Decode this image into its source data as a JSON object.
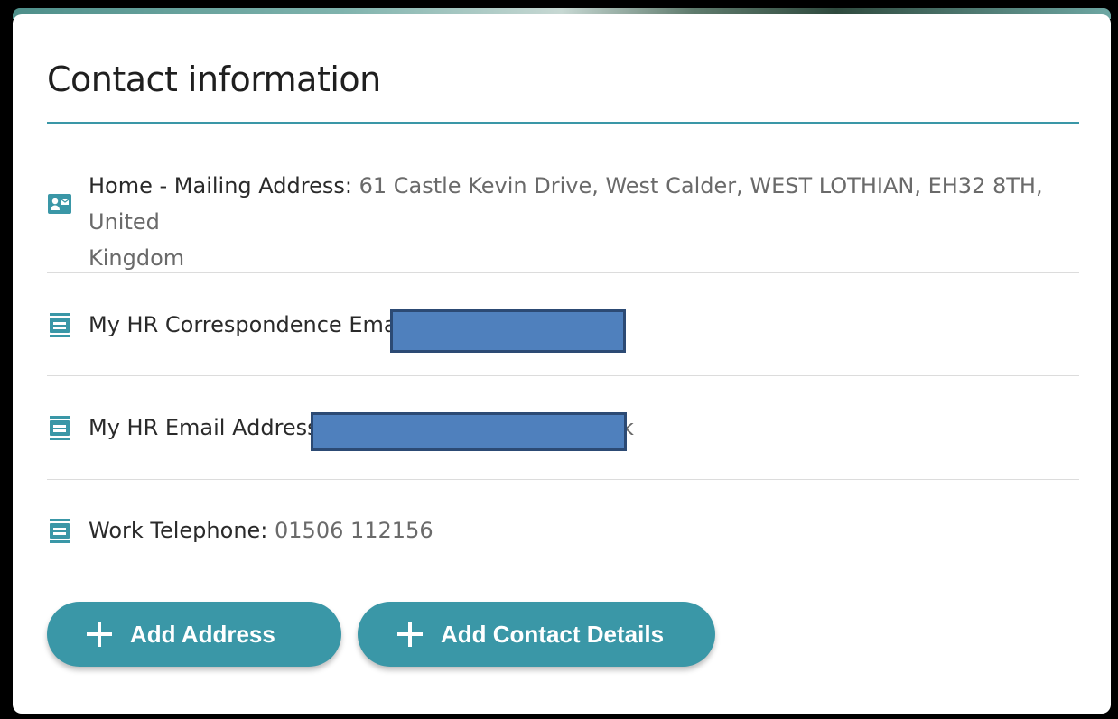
{
  "section": {
    "title": "Contact information"
  },
  "contacts": [
    {
      "icon": "address-card-icon",
      "label": "Home - Mailing Address:",
      "value": "61 Castle Kevin Drive, West Calder, WEST LOTHIAN, EH32 8TH, United",
      "value_line2": "Kingdom"
    },
    {
      "icon": "contact-book-icon",
      "label": "My HR Correspondence Email:",
      "value": ""
    },
    {
      "icon": "contact-book-icon",
      "label": "My HR Email Address:",
      "value": "",
      "trailing": "k"
    },
    {
      "icon": "contact-book-icon",
      "label": "Work Telephone:",
      "value": "01506 112156"
    }
  ],
  "actions": {
    "add_address": "Add Address",
    "add_contact_details": "Add Contact Details"
  },
  "colors": {
    "accent": "#3a97a7",
    "redaction": "#4f80bd",
    "divider": "#dcdcdc"
  }
}
